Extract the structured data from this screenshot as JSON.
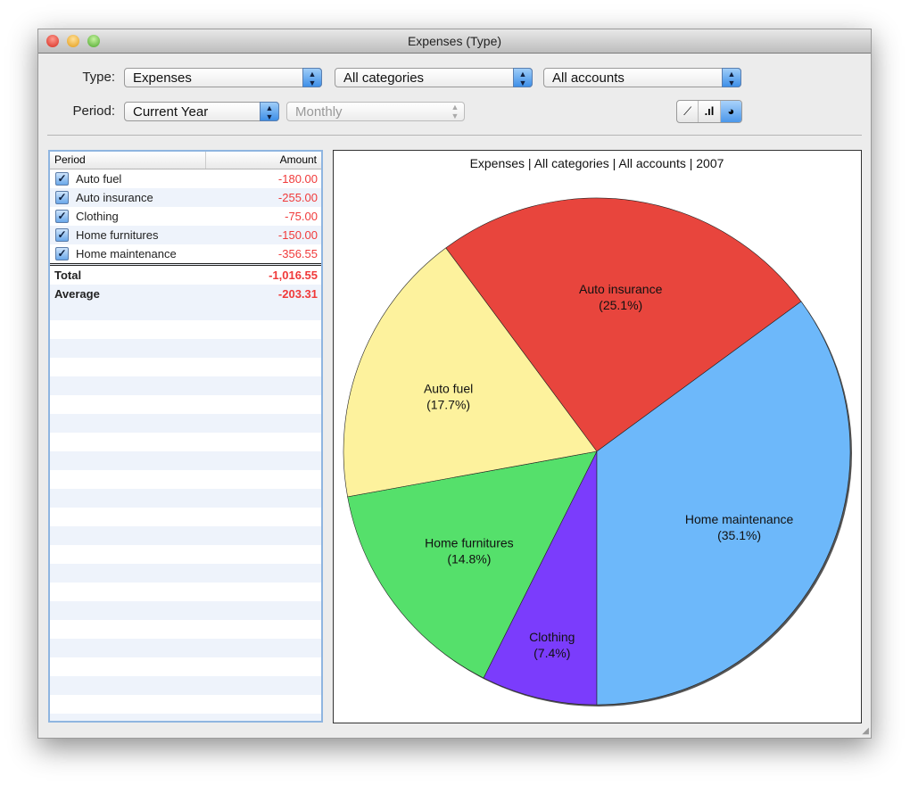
{
  "window": {
    "title": "Expenses (Type)"
  },
  "toolbar": {
    "type_label": "Type:",
    "type_value": "Expenses",
    "category_value": "All categories",
    "account_value": "All accounts",
    "period_label": "Period:",
    "period_value": "Current Year",
    "interval_value": "Monthly",
    "view_modes": [
      "line-chart-icon",
      "bar-chart-icon",
      "pie-chart-icon"
    ],
    "selected_view": "pie"
  },
  "table": {
    "headers": [
      "Period",
      "Amount"
    ],
    "rows": [
      {
        "name": "Auto fuel",
        "amount": "-180.00",
        "checked": true
      },
      {
        "name": "Auto insurance",
        "amount": "-255.00",
        "checked": true
      },
      {
        "name": "Clothing",
        "amount": "-75.00",
        "checked": true
      },
      {
        "name": "Home furnitures",
        "amount": "-150.00",
        "checked": true
      },
      {
        "name": "Home maintenance",
        "amount": "-356.55",
        "checked": true
      }
    ],
    "total_label": "Total",
    "total": "-1,016.55",
    "average_label": "Average",
    "average": "-203.31"
  },
  "chart_data": {
    "type": "pie",
    "title": "Expenses | All categories | All accounts | 2007",
    "slices": [
      {
        "label": "Clothing",
        "pct_label": "(7.4%)",
        "value": 75.0,
        "color": "#7b3cfc"
      },
      {
        "label": "Home furnitures",
        "pct_label": "(14.8%)",
        "value": 150.0,
        "color": "#55e06b"
      },
      {
        "label": "Auto fuel",
        "pct_label": "(17.7%)",
        "value": 180.0,
        "color": "#fdf29d"
      },
      {
        "label": "Auto insurance",
        "pct_label": "(25.1%)",
        "value": 255.0,
        "color": "#e8453d"
      },
      {
        "label": "Home maintenance",
        "pct_label": "(35.1%)",
        "value": 356.55,
        "color": "#6db8fa"
      }
    ]
  }
}
